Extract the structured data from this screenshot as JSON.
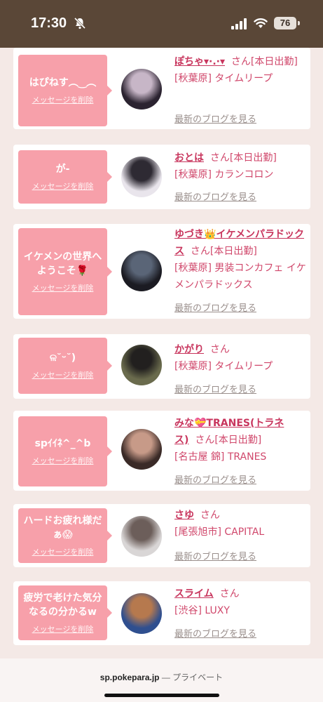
{
  "status_bar": {
    "time": "17:30",
    "battery": "76"
  },
  "cards": [
    {
      "msg": "はぴねす︵‿︵",
      "delete": "メッセージを削除",
      "name": "ぽちゃ▾·.·▾",
      "san": "さん",
      "shukkin": "[本日出勤]",
      "location": "[秋葉原] タイムリープ",
      "blog": "最新のブログを見る",
      "avatar_colors": [
        "#2b2330",
        "#c7b6c7"
      ]
    },
    {
      "msg": "が-",
      "delete": "メッセージを削除",
      "name": "おとは",
      "san": "さん",
      "shukkin": "[本日出勤]",
      "location": "[秋葉原] カランコロン",
      "blog": "最新のブログを見る",
      "avatar_colors": [
        "#e9e5ec",
        "#2e2a33"
      ]
    },
    {
      "msg": "イケメンの世界へようこそ🌹",
      "delete": "メッセージを削除",
      "name": "ゆづき👑イケメンパラドックス",
      "san": "さん",
      "shukkin": "[本日出勤]",
      "location": "[秋葉原] 男装コンカフェ イケメンパラドックス",
      "blog": "最新のブログを見る",
      "avatar_colors": [
        "#1b1b22",
        "#5a6577"
      ]
    },
    {
      "msg": "ଳ˘ᵕ˘)",
      "delete": "メッセージを削除",
      "name": "かがり",
      "san": "さん",
      "shukkin": "",
      "location": "[秋葉原] タイムリープ",
      "blog": "最新のブログを見る",
      "avatar_colors": [
        "#6a6b4d",
        "#22201f"
      ]
    },
    {
      "msg": "spｲｲﾈ^_^b",
      "delete": "メッセージを削除",
      "name": "みな💝TRANES(トラネス)",
      "san": "さん",
      "shukkin": "[本日出勤]",
      "location": "[名古屋 錦] TRANES",
      "blog": "最新のブログを見る",
      "avatar_colors": [
        "#3a2a27",
        "#c79a88"
      ]
    },
    {
      "msg": "ハードお疲れ様だぁ😱",
      "delete": "メッセージを削除",
      "name": "さゆ",
      "san": "さん",
      "shukkin": "",
      "location": "[尾張旭市] CAPITAL",
      "blog": "最新のブログを見る",
      "avatar_colors": [
        "#d9d6d6",
        "#6c5e5a"
      ]
    },
    {
      "msg": "疲労で老けた気分なるの分かるw",
      "delete": "メッセージを削除",
      "name": "スライム",
      "san": "さん",
      "shukkin": "",
      "location": "[渋谷] LUXY",
      "blog": "最新のブログを見る",
      "avatar_colors": [
        "#2f4f8f",
        "#b6794e"
      ]
    }
  ],
  "browser": {
    "url": "sp.pokepara.jp",
    "mode": "— プライベート"
  }
}
